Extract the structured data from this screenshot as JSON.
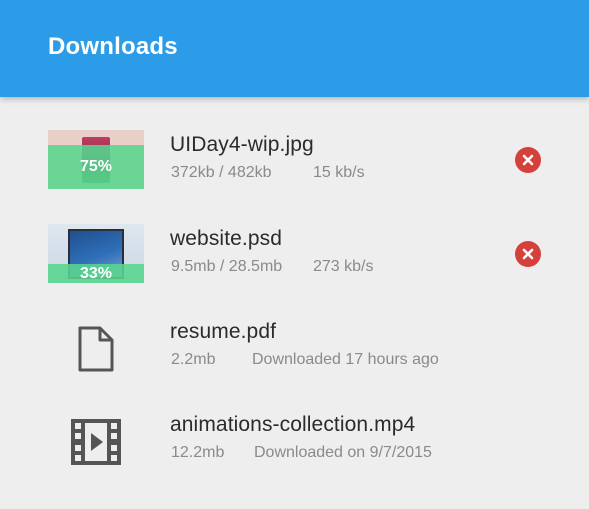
{
  "header": {
    "title": "Downloads"
  },
  "downloads": [
    {
      "name": "UIDay4-wip.jpg",
      "progress_label": "75%",
      "progress": 0.75,
      "size": "372kb / 482kb",
      "speed": "15 kb/s",
      "action_icon": "cancel-icon"
    },
    {
      "name": "website.psd",
      "progress_label": "33%",
      "progress": 0.33,
      "size": "9.5mb / 28.5mb",
      "speed": "273 kb/s",
      "action_icon": "cancel-icon"
    },
    {
      "name": "resume.pdf",
      "size": "2.2mb",
      "status": "Downloaded 17 hours ago",
      "icon": "document-icon"
    },
    {
      "name": "animations-collection.mp4",
      "size": "12.2mb",
      "status": "Downloaded on 9/7/2015",
      "icon": "video-icon"
    }
  ],
  "colors": {
    "header": "#2c9ce8",
    "progress_fill": "#58d68d",
    "cancel": "#d6403a",
    "background": "#eeeeee"
  }
}
